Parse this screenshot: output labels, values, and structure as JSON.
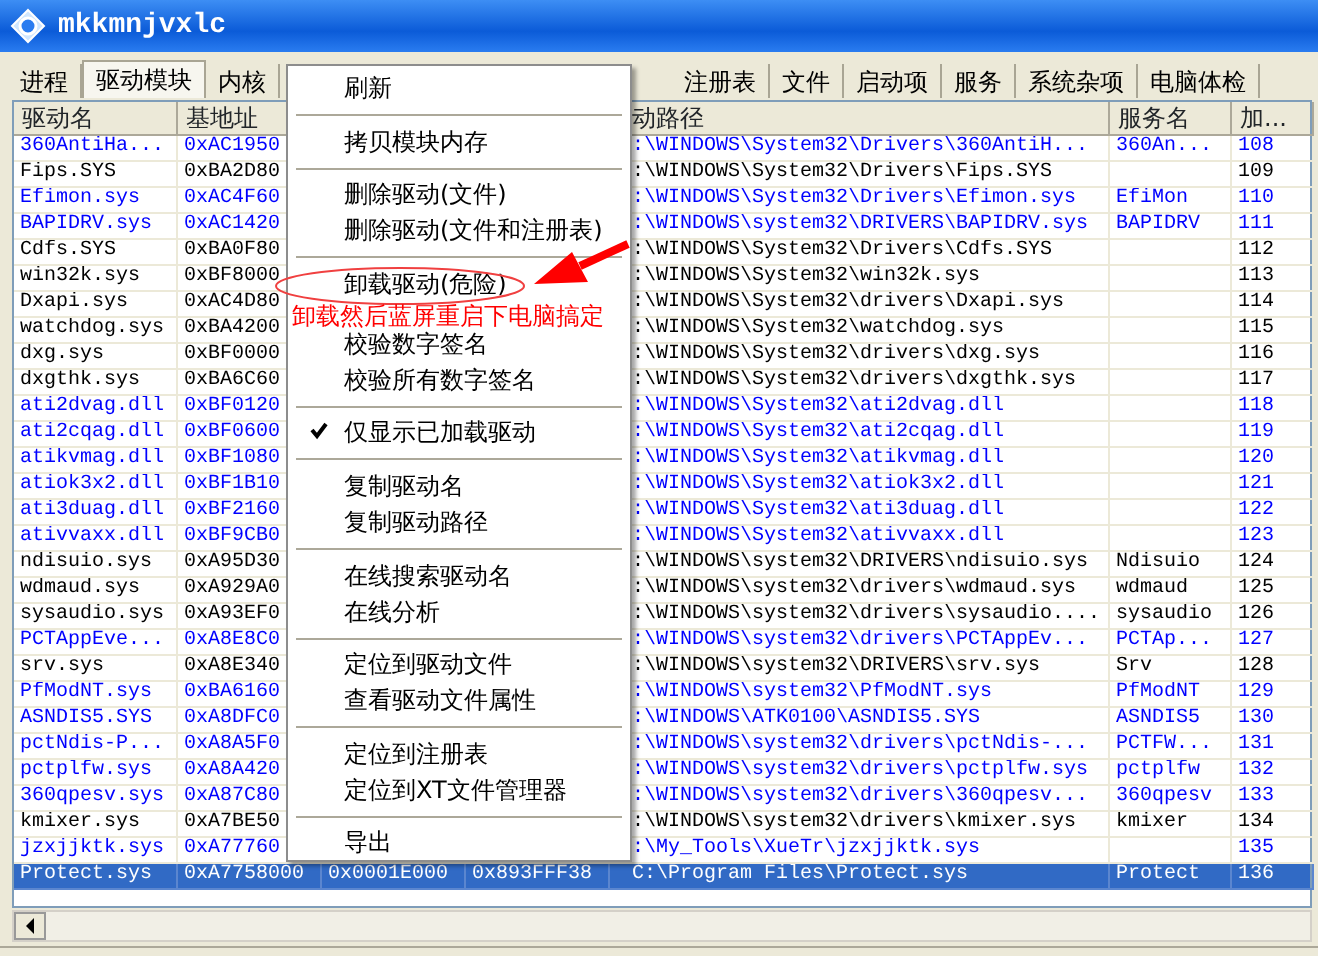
{
  "window": {
    "title": "mkkmnjvxlc"
  },
  "tabs": [
    {
      "label": "进程",
      "selected": false
    },
    {
      "label": "驱动模块",
      "selected": true
    },
    {
      "label": "内核",
      "selected": false
    },
    {
      "label": "注册表",
      "selected": false
    },
    {
      "label": "文件",
      "selected": false
    },
    {
      "label": "启动项",
      "selected": false
    },
    {
      "label": "服务",
      "selected": false
    },
    {
      "label": "系统杂项",
      "selected": false
    },
    {
      "label": "电脑体检",
      "selected": false
    }
  ],
  "table": {
    "columns": [
      "驱动名",
      "基地址",
      "动路径",
      "服务名",
      "加..."
    ],
    "rows": [
      {
        "name": "360AntiHa...",
        "base": "0xAC1950",
        "path": ":\\WINDOWS\\System32\\Drivers\\360AntiH...",
        "service": "360An...",
        "load": "108",
        "color": "#0000ff",
        "selected": false
      },
      {
        "name": "Fips.SYS",
        "base": "0xBA2D80",
        "path": ":\\WINDOWS\\System32\\Drivers\\Fips.SYS",
        "load": "109",
        "color": "#000000",
        "selected": false
      },
      {
        "name": "Efimon.sys",
        "base": "0xAC4F60",
        "path": ":\\WINDOWS\\System32\\Drivers\\Efimon.sys",
        "service": "EfiMon",
        "load": "110",
        "color": "#0000ff",
        "selected": false
      },
      {
        "name": "BAPIDRV.sys",
        "base": "0xAC1420",
        "path": ":\\WINDOWS\\system32\\DRIVERS\\BAPIDRV.sys",
        "service": "BAPIDRV",
        "load": "111",
        "color": "#0000ff",
        "selected": false
      },
      {
        "name": "Cdfs.SYS",
        "base": "0xBA0F80",
        "path": ":\\WINDOWS\\System32\\Drivers\\Cdfs.SYS",
        "load": "112",
        "color": "#000000",
        "selected": false
      },
      {
        "name": "win32k.sys",
        "base": "0xBF8000",
        "path": ":\\WINDOWS\\System32\\win32k.sys",
        "load": "113",
        "color": "#000000",
        "selected": false
      },
      {
        "name": "Dxapi.sys",
        "base": "0xAC4D80",
        "path": ":\\WINDOWS\\System32\\drivers\\Dxapi.sys",
        "load": "114",
        "color": "#000000",
        "selected": false
      },
      {
        "name": "watchdog.sys",
        "base": "0xBA4200",
        "path": ":\\WINDOWS\\System32\\watchdog.sys",
        "load": "115",
        "color": "#000000",
        "selected": false
      },
      {
        "name": "dxg.sys",
        "base": "0xBF0000",
        "path": ":\\WINDOWS\\System32\\drivers\\dxg.sys",
        "load": "116",
        "color": "#000000",
        "selected": false
      },
      {
        "name": "dxgthk.sys",
        "base": "0xBA6C60",
        "path": ":\\WINDOWS\\System32\\drivers\\dxgthk.sys",
        "load": "117",
        "color": "#000000",
        "selected": false
      },
      {
        "name": "ati2dvag.dll",
        "base": "0xBF0120",
        "path": ":\\WINDOWS\\System32\\ati2dvag.dll",
        "load": "118",
        "color": "#0000ff",
        "selected": false
      },
      {
        "name": "ati2cqag.dll",
        "base": "0xBF0600",
        "path": ":\\WINDOWS\\System32\\ati2cqag.dll",
        "load": "119",
        "color": "#0000ff",
        "selected": false
      },
      {
        "name": "atikvmag.dll",
        "base": "0xBF1080",
        "path": ":\\WINDOWS\\System32\\atikvmag.dll",
        "load": "120",
        "color": "#0000ff",
        "selected": false
      },
      {
        "name": "atiok3x2.dll",
        "base": "0xBF1B10",
        "path": ":\\WINDOWS\\System32\\atiok3x2.dll",
        "load": "121",
        "color": "#0000ff",
        "selected": false
      },
      {
        "name": "ati3duag.dll",
        "base": "0xBF2160",
        "path": ":\\WINDOWS\\System32\\ati3duag.dll",
        "load": "122",
        "color": "#0000ff",
        "selected": false
      },
      {
        "name": "ativvaxx.dll",
        "base": "0xBF9CB0",
        "path": ":\\WINDOWS\\System32\\ativvaxx.dll",
        "load": "123",
        "color": "#0000ff",
        "selected": false
      },
      {
        "name": "ndisuio.sys",
        "base": "0xA95D30",
        "path": ":\\WINDOWS\\system32\\DRIVERS\\ndisuio.sys",
        "service": "Ndisuio",
        "load": "124",
        "color": "#000000",
        "selected": false
      },
      {
        "name": "wdmaud.sys",
        "base": "0xA929A0",
        "path": ":\\WINDOWS\\system32\\drivers\\wdmaud.sys",
        "service": "wdmaud",
        "load": "125",
        "color": "#000000",
        "selected": false
      },
      {
        "name": "sysaudio.sys",
        "base": "0xA93EF0",
        "path": ":\\WINDOWS\\system32\\drivers\\sysaudio....",
        "service": "sysaudio",
        "load": "126",
        "color": "#000000",
        "selected": false
      },
      {
        "name": "PCTAppEve...",
        "base": "0xA8E8C0",
        "path": ":\\WINDOWS\\system32\\drivers\\PCTAppEv...",
        "service": "PCTAp...",
        "load": "127",
        "color": "#0000ff",
        "selected": false
      },
      {
        "name": "srv.sys",
        "base": "0xA8E340",
        "path": ":\\WINDOWS\\system32\\DRIVERS\\srv.sys",
        "service": "Srv",
        "load": "128",
        "color": "#000000",
        "selected": false
      },
      {
        "name": "PfModNT.sys",
        "base": "0xBA6160",
        "path": ":\\WINDOWS\\system32\\PfModNT.sys",
        "service": "PfModNT",
        "load": "129",
        "color": "#0000ff",
        "selected": false
      },
      {
        "name": "ASNDIS5.SYS",
        "base": "0xA8DFC0",
        "path": ":\\WINDOWS\\ATK0100\\ASNDIS5.SYS",
        "service": "ASNDIS5",
        "load": "130",
        "color": "#0000ff",
        "selected": false
      },
      {
        "name": "pctNdis-P...",
        "base": "0xA8A5F0",
        "path": ":\\WINDOWS\\system32\\drivers\\pctNdis-...",
        "service": "PCTFW...",
        "load": "131",
        "color": "#0000ff",
        "selected": false
      },
      {
        "name": "pctplfw.sys",
        "base": "0xA8A420",
        "path": ":\\WINDOWS\\system32\\drivers\\pctplfw.sys",
        "service": "pctplfw",
        "load": "132",
        "color": "#0000ff",
        "selected": false
      },
      {
        "name": "360qpesv.sys",
        "base": "0xA87C80",
        "path": ":\\WINDOWS\\system32\\drivers\\360qpesv...",
        "service": "360qpesv",
        "load": "133",
        "color": "#0000ff",
        "selected": false
      },
      {
        "name": "kmixer.sys",
        "base": "0xA7BE50",
        "path": ":\\WINDOWS\\system32\\drivers\\kmixer.sys",
        "service": "kmixer",
        "load": "134",
        "color": "#000000",
        "selected": false
      },
      {
        "name": "jzxjjktk.sys",
        "base": "0xA77760",
        "path": ":\\My_Tools\\XueTr\\jzxjjktk.sys",
        "load": "135",
        "color": "#0000ff",
        "selected": false
      },
      {
        "name": "Protect.sys",
        "base": "0xA7758000",
        "size": "0x0001E000",
        "object": "0x893FFF38",
        "path": "C:\\Program Files\\Protect.sys",
        "service": "Protect",
        "load": "136",
        "selected": true
      }
    ]
  },
  "context_menu": {
    "groups": [
      [
        {
          "label": "刷新",
          "checked": false
        }
      ],
      [
        {
          "label": "拷贝模块内存",
          "checked": false
        }
      ],
      [
        {
          "label": "删除驱动(文件)",
          "checked": false
        },
        {
          "label": "删除驱动(文件和注册表)",
          "checked": false
        }
      ],
      [
        {
          "label": "卸载驱动(危险)",
          "checked": false
        },
        {
          "label": "校验数字签名",
          "checked": false
        },
        {
          "label": "校验所有数字签名",
          "checked": false
        }
      ],
      [
        {
          "label": "仅显示已加载驱动",
          "checked": true
        }
      ],
      [
        {
          "label": "复制驱动名",
          "checked": false
        },
        {
          "label": "复制驱动路径",
          "checked": false
        }
      ],
      [
        {
          "label": "在线搜索驱动名",
          "checked": false
        },
        {
          "label": "在线分析",
          "checked": false
        }
      ],
      [
        {
          "label": "定位到驱动文件",
          "checked": false
        },
        {
          "label": "查看驱动文件属性",
          "checked": false
        }
      ],
      [
        {
          "label": "定位到注册表",
          "checked": false
        },
        {
          "label": "定位到XT文件管理器",
          "checked": false
        }
      ],
      [
        {
          "label": "导出",
          "checked": false
        }
      ]
    ]
  },
  "annotation": {
    "text": "卸载然后蓝屏重启下电脑搞定"
  }
}
